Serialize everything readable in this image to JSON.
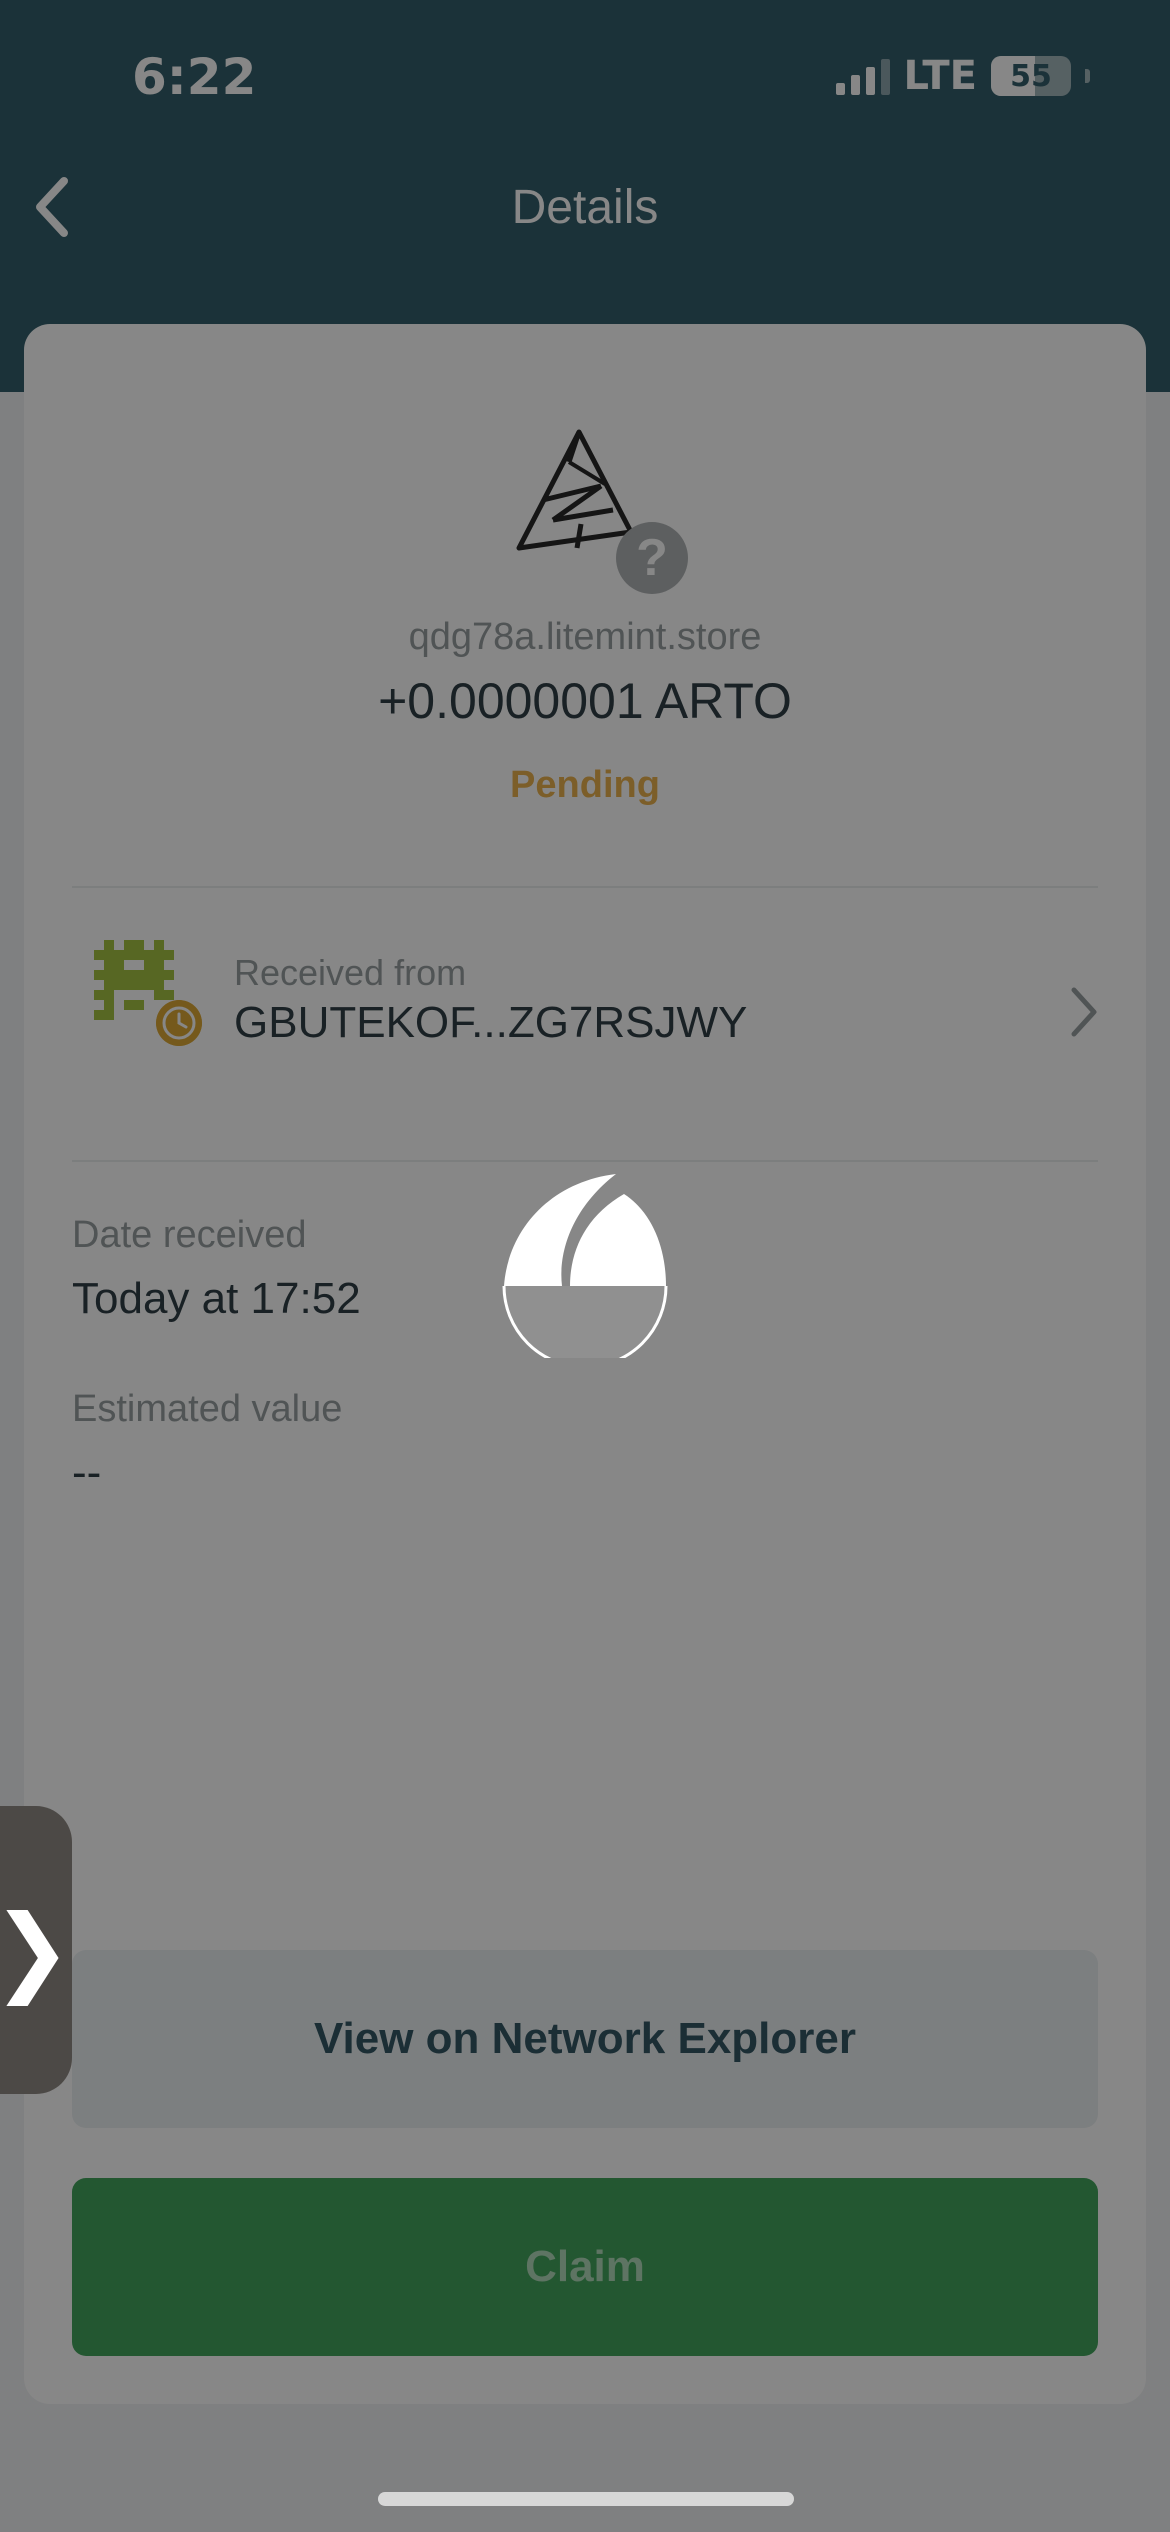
{
  "status_bar": {
    "time": "6:22",
    "network": "LTE",
    "battery": "55"
  },
  "header": {
    "title": "Details",
    "back_icon": "chevron-left-icon"
  },
  "asset": {
    "domain": "qdg78a.litemint.store",
    "amount": "+0.0000001 ARTO",
    "status": "Pending",
    "unknown_badge": "?"
  },
  "sender": {
    "label": "Received from",
    "address": "GBUTEKOF...ZG7RSJWY"
  },
  "date": {
    "label": "Date received",
    "value": "Today at 17:52"
  },
  "estimate": {
    "label": "Estimated value",
    "value": "--"
  },
  "actions": {
    "explorer_label": "View on Network Explorer",
    "claim_label": "Claim"
  },
  "side_tab": {
    "glyph": "❯"
  },
  "colors": {
    "header": "#1e4e5c",
    "pending": "#e8a93c",
    "claim": "#2e9c4b"
  }
}
